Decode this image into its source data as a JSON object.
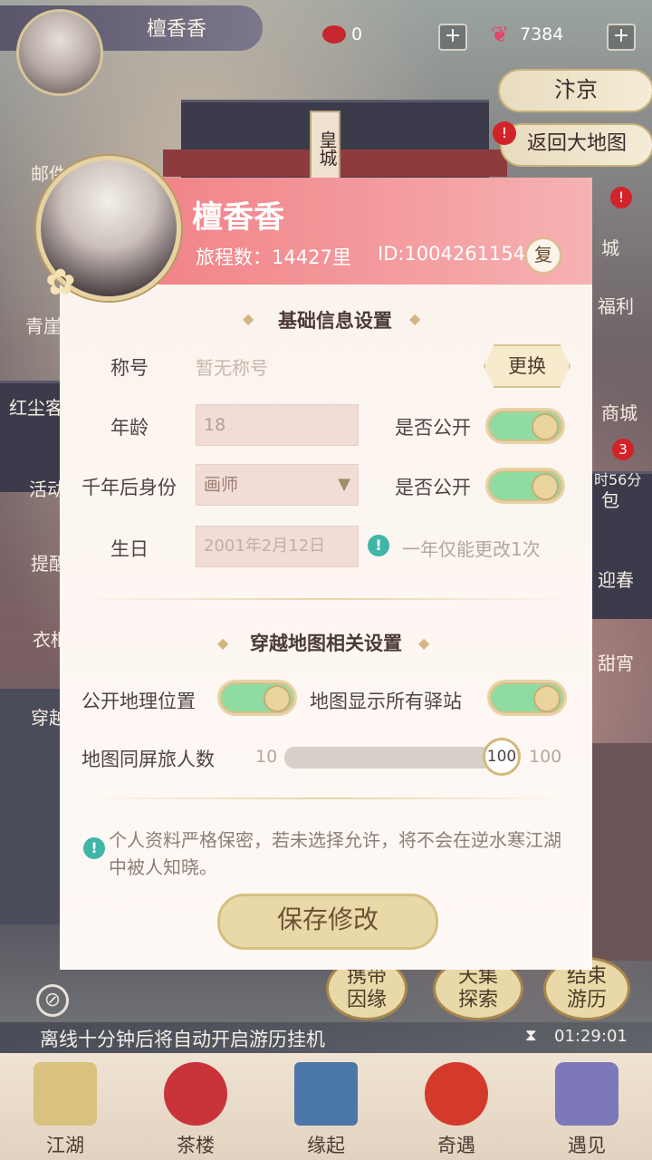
{
  "header": {
    "player_name": "檀香香",
    "beans": "0",
    "butterflies": "7384",
    "plus": "+",
    "location": "汴京",
    "back_to_map": "返回大地图"
  },
  "map_labels": {
    "palace": "皇城",
    "mail": "邮件",
    "cliff": "青崖",
    "inn": "红尘客",
    "events": "活动",
    "memo": "提醒",
    "clothes": "衣柜",
    "travel": "穿越",
    "city": "城",
    "welfare": "福利",
    "shop": "商城",
    "redpack_timer": "时56分",
    "redpack": "包",
    "redpack_badge": "3",
    "spring": "迎春",
    "sweet": "甜宵",
    "alert": "!"
  },
  "profile": {
    "username": "檀香香",
    "journey": "旅程数：14427里",
    "id": "ID:1004261154",
    "copy": "复"
  },
  "basic": {
    "title": "基础信息设置",
    "title_label": "称号",
    "title_value": "暂无称号",
    "change_btn": "更换",
    "age_label": "年龄",
    "age_value": "18",
    "public_label": "是否公开",
    "identity_label": "千年后身份",
    "identity_value": "画师",
    "public_label2": "是否公开",
    "birthday_label": "生日",
    "birthday_value": "2001年2月12日",
    "birthday_note": "一年仅能更改1次"
  },
  "map_settings": {
    "title": "穿越地图相关设置",
    "geo_label": "公开地理位置",
    "stations_label": "地图显示所有驿站",
    "travelers_label": "地图同屏旅人数",
    "slider_min": "10",
    "slider_value": "100",
    "slider_max": "100",
    "slider_fraction": 1.0
  },
  "privacy_note": "个人资料严格保密，若未选择允许，将不会在逆水寒江湖中被人知晓。",
  "save_btn": "保存修改",
  "bottom_cards": {
    "card1": "携带\n因缘",
    "card2": "天集\n探索",
    "card3": "结束\n游历"
  },
  "offline_text": "离线十分钟后将自动开启游历挂机",
  "timer": "01:29:01",
  "nav": [
    "江湖",
    "茶楼",
    "缘起",
    "奇遇",
    "遇见"
  ],
  "colors": {
    "header_pink": "#f07a80",
    "toggle_on": "#8edca2",
    "info_teal": "#3fb6a8"
  },
  "toggles": {
    "age_public": true,
    "identity_public": true,
    "geo_public": true,
    "show_stations": true
  }
}
